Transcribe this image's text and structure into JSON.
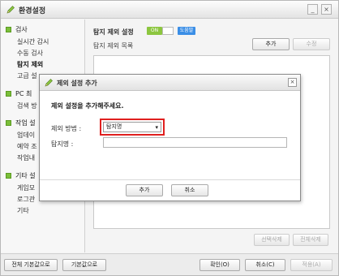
{
  "window": {
    "title": "환경설정",
    "minimize_glyph": "_",
    "close_glyph": "×"
  },
  "sidebar": {
    "cat_scan": "검사",
    "scan_realtime": "실시간 감시",
    "scan_manual": "수동 검사",
    "scan_exclude": "탐지 제외",
    "scan_advanced": "고급 설",
    "cat_pc": "PC 최",
    "pc_check": "검색 방",
    "cat_task": "작업 설",
    "task_update": "업데이",
    "task_schedule": "예약 조",
    "task_other": "작업내",
    "cat_other": "기타 설",
    "other_game": "게임모",
    "other_log": "로그관",
    "other_misc": "기타"
  },
  "main": {
    "section_title": "탐지 제외 설정",
    "toggle_on": "ON",
    "help_badge": "도움말",
    "list_title": "탐지 제외 목록",
    "add_button": "추가",
    "edit_button": "수정",
    "delete_selected": "선택삭제",
    "delete_all": "전체삭제"
  },
  "bottom": {
    "reset_all": "전체 기본값으로",
    "reset_default": "기본값으로",
    "confirm": "확인(O)",
    "cancel": "취소(C)",
    "apply": "적용(A)"
  },
  "dialog": {
    "title": "제외 설정 추가",
    "close_glyph": "×",
    "heading": "제외 설정을 추가해주세요.",
    "method_label": "제외 방법 :",
    "method_value": "탐지명",
    "name_label": "탐지명 :",
    "name_value": "",
    "add_button": "추가",
    "cancel_button": "취소"
  },
  "colors": {
    "accent_green": "#8cc63f",
    "help_blue": "#3a8ee6",
    "highlight_red": "#e0201f"
  },
  "icons": {
    "window": "pen-icon",
    "dialog": "pen-icon",
    "category": "green-square-icon",
    "select_arrow": "chevron-down-icon"
  }
}
